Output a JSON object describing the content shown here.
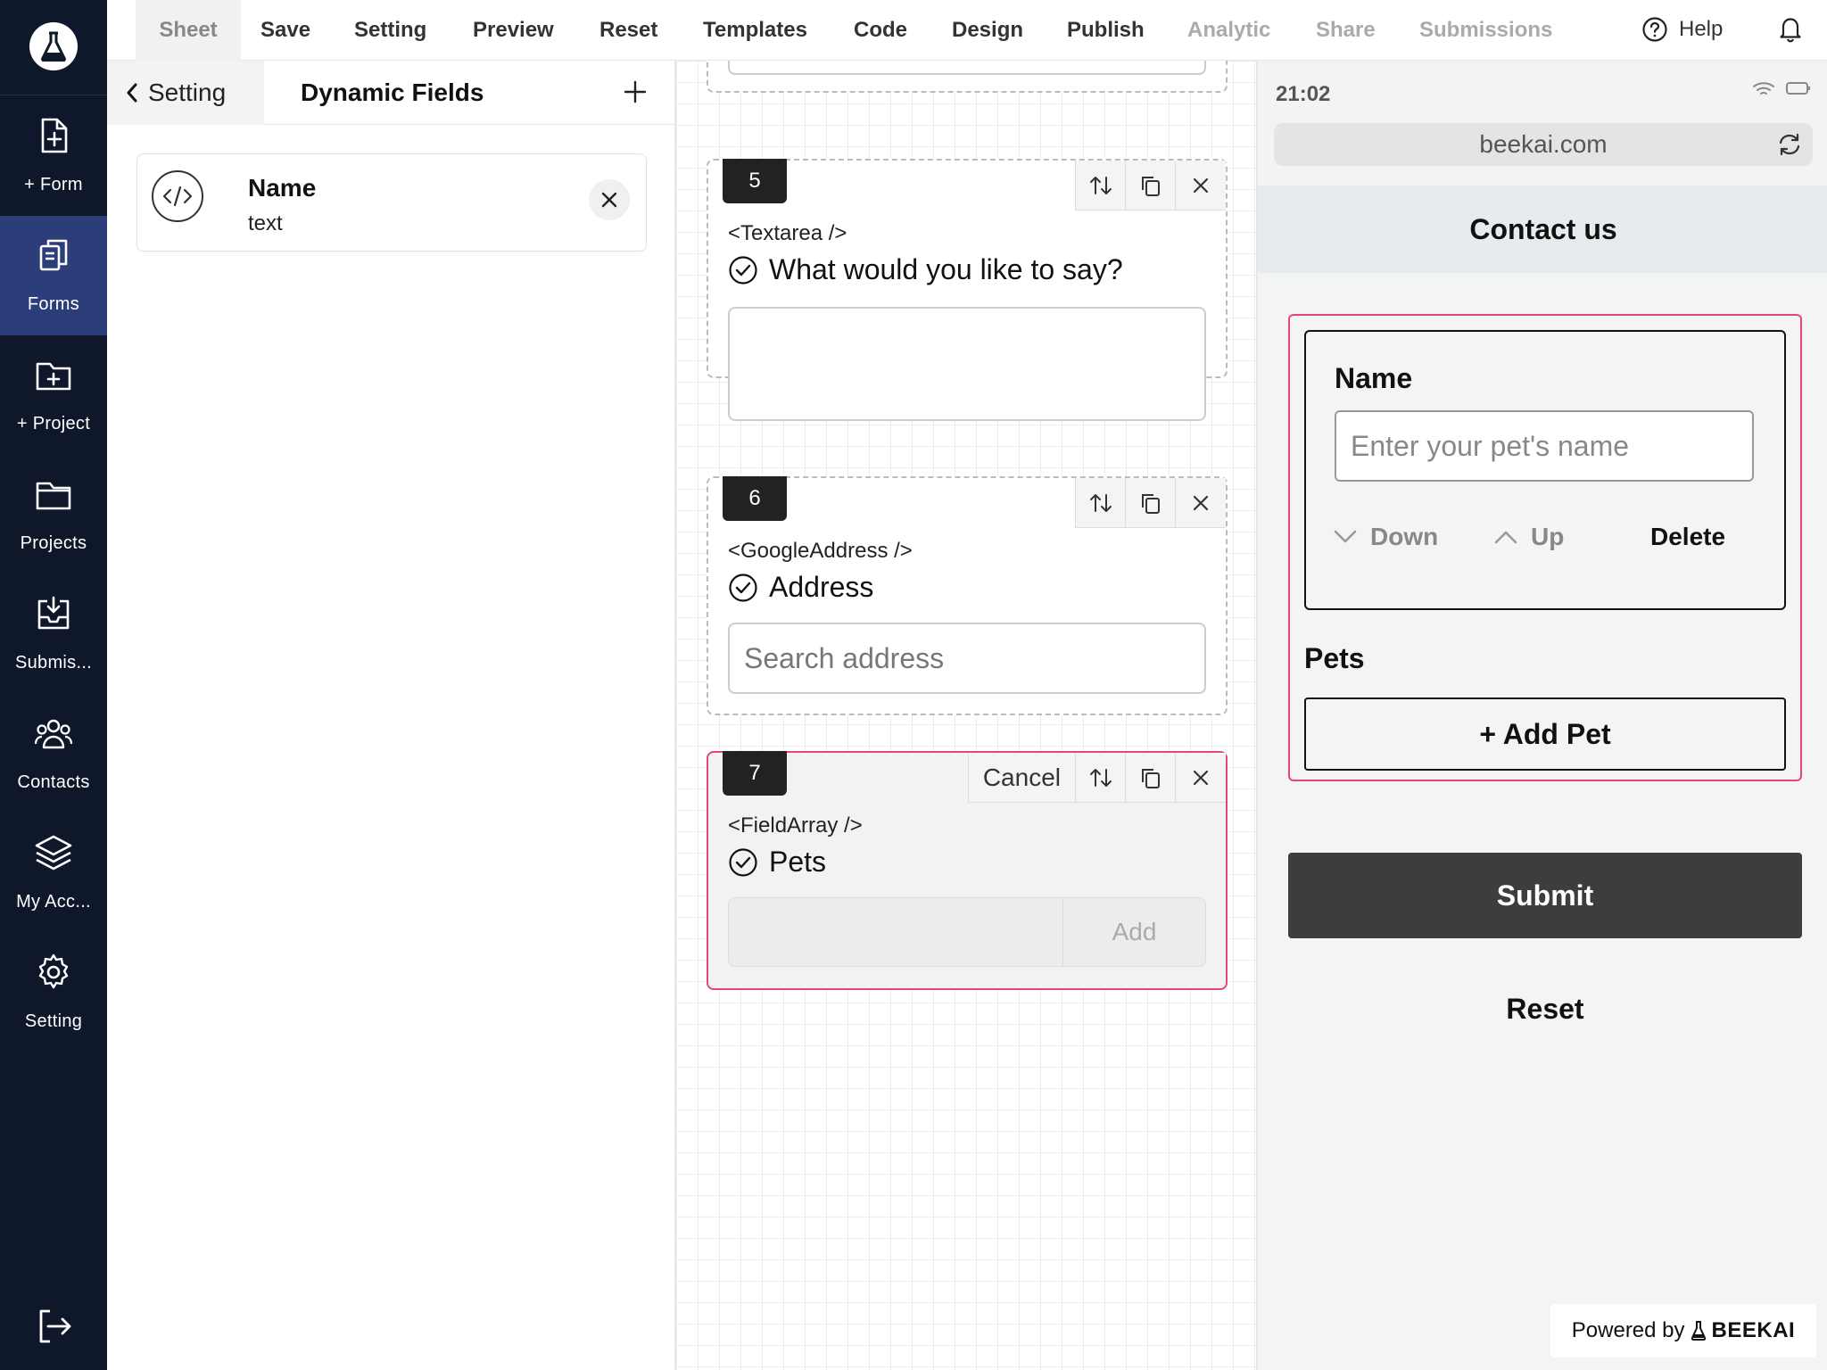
{
  "sidebar": {
    "logo": "flask-icon",
    "items": [
      {
        "label": "+ Form",
        "icon": "file-plus-icon"
      },
      {
        "label": "Forms",
        "icon": "forms-icon",
        "active": true
      },
      {
        "label": "+ Project",
        "icon": "folder-plus-icon"
      },
      {
        "label": "Projects",
        "icon": "folder-icon"
      },
      {
        "label": "Submis...",
        "icon": "inbox-icon"
      },
      {
        "label": "Contacts",
        "icon": "users-icon"
      },
      {
        "label": "My Acc...",
        "icon": "layers-icon"
      },
      {
        "label": "Setting",
        "icon": "gear-icon"
      }
    ],
    "logout_icon": "logout-icon",
    "active_color": "#2c3e7a",
    "background": "#0f172a"
  },
  "menu": {
    "items": [
      {
        "label": "Sheet",
        "state": "active"
      },
      {
        "label": "Save",
        "state": "normal"
      },
      {
        "label": "Setting",
        "state": "normal"
      },
      {
        "label": "Preview",
        "state": "normal"
      },
      {
        "label": "Reset",
        "state": "normal"
      },
      {
        "label": "Templates",
        "state": "normal"
      },
      {
        "label": "Code",
        "state": "normal"
      },
      {
        "label": "Design",
        "state": "normal"
      },
      {
        "label": "Publish",
        "state": "normal"
      },
      {
        "label": "Analytic",
        "state": "disabled"
      },
      {
        "label": "Share",
        "state": "disabled"
      },
      {
        "label": "Submissions",
        "state": "disabled"
      }
    ],
    "help_label": "Help"
  },
  "settings_panel": {
    "back_label": "Setting",
    "title": "Dynamic Fields",
    "field": {
      "name": "Name",
      "type": "text"
    }
  },
  "canvas": {
    "blocks": [
      {
        "number": "5",
        "tag": "<Textarea />",
        "question": "What would you like to say?"
      },
      {
        "number": "6",
        "tag": "<GoogleAddress />",
        "question": "Address",
        "placeholder": "Search address"
      },
      {
        "number": "7",
        "tag": "<FieldArray />",
        "question": "Pets",
        "cancel_label": "Cancel",
        "add_label": "Add"
      }
    ],
    "selected_color": "#e1467c"
  },
  "preview": {
    "time": "21:02",
    "url": "beekai.com",
    "form_title": "Contact us",
    "item": {
      "label": "Name",
      "placeholder": "Enter your pet's name",
      "down_label": "Down",
      "up_label": "Up",
      "delete_label": "Delete"
    },
    "array_label": "Pets",
    "add_button": "+ Add Pet",
    "submit_label": "Submit",
    "reset_label": "Reset",
    "powered_prefix": "Powered by",
    "powered_brand": "BEEKAI"
  }
}
